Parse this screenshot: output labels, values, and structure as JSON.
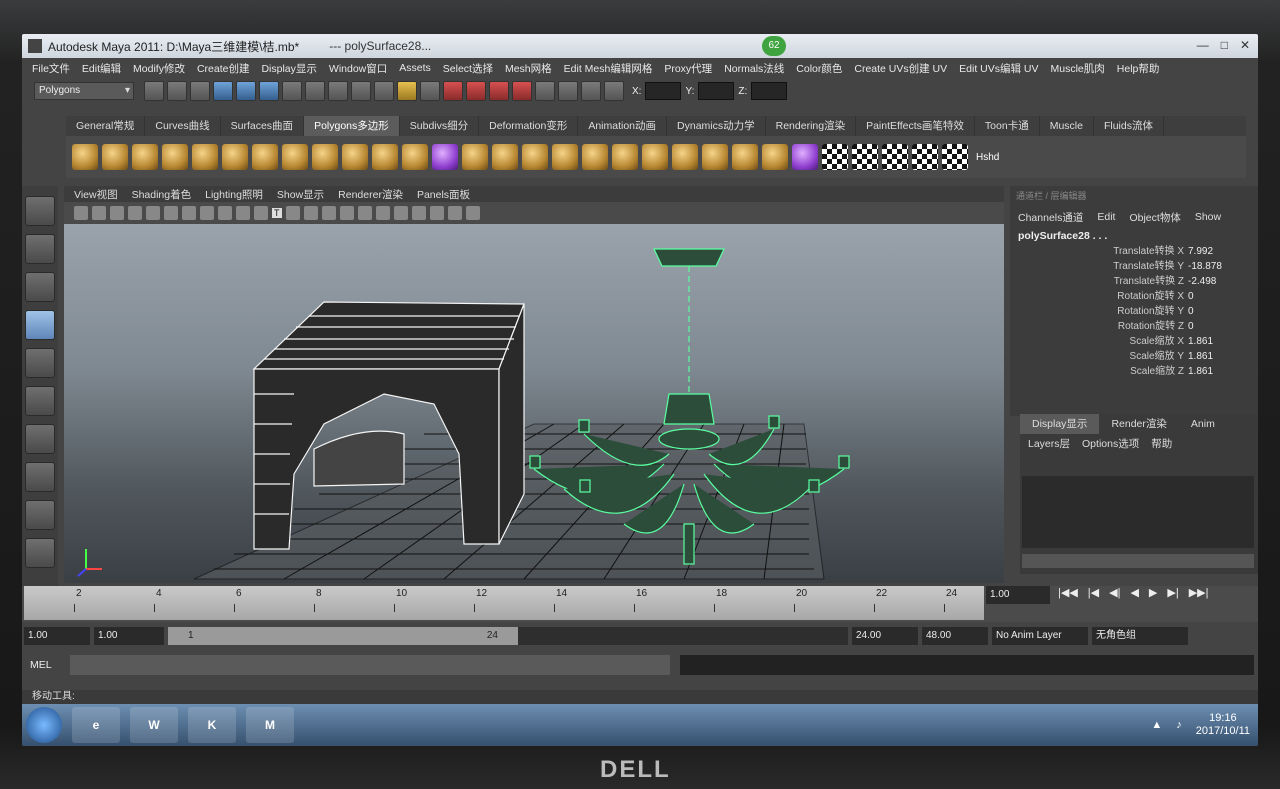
{
  "window": {
    "title": "Autodesk Maya 2011: D:\\Maya三维建模\\桔.mb*",
    "subtitle": "---  polySurface28...",
    "badge": "62",
    "buttons": [
      "—",
      "□",
      "✕"
    ]
  },
  "menu": [
    "File文件",
    "Edit编辑",
    "Modify修改",
    "Create创建",
    "Display显示",
    "Window窗口",
    "Assets",
    "Select选择",
    "Mesh网格",
    "Edit Mesh编辑网格",
    "Proxy代理",
    "Normals法线",
    "Color颜色",
    "Create UVs创建 UV",
    "Edit UVs编辑 UV",
    "Muscle肌肉",
    "Help帮助"
  ],
  "status": {
    "mode": "Polygons",
    "x_label": "X:",
    "y_label": "Y:",
    "z_label": "Z:"
  },
  "shelf_tabs": [
    "General常规",
    "Curves曲线",
    "Surfaces曲面",
    "Polygons多边形",
    "Subdivs细分",
    "Deformation变形",
    "Animation动画",
    "Dynamics动力学",
    "Rendering渲染",
    "PaintEffects画笔特效",
    "Toon卡通",
    "Muscle",
    "Fluids流体"
  ],
  "shelf_active": "Polygons多边形",
  "shelf_hshd": "Hshd",
  "viewport": {
    "menu": [
      "View视图",
      "Shading着色",
      "Lighting照明",
      "Show显示",
      "Renderer渲染",
      "Panels面板"
    ],
    "tooltip": "T"
  },
  "channel_box": {
    "header": "通道栏 / 层编辑器",
    "tabs": [
      "Channels通道",
      "Edit",
      "Object物体",
      "Show"
    ],
    "object": "polySurface28 . . .",
    "attributes": [
      {
        "name": "Translate转换 X",
        "value": "7.992"
      },
      {
        "name": "Translate转换 Y",
        "value": "-18.878"
      },
      {
        "name": "Translate转换 Z",
        "value": "-2.498"
      },
      {
        "name": "Rotation旋转 X",
        "value": "0"
      },
      {
        "name": "Rotation旋转 Y",
        "value": "0"
      },
      {
        "name": "Rotation旋转 Z",
        "value": "0"
      },
      {
        "name": "Scale缩放 X",
        "value": "1.861"
      },
      {
        "name": "Scale缩放 Y",
        "value": "1.861"
      },
      {
        "name": "Scale缩放 Z",
        "value": "1.861"
      }
    ]
  },
  "layer_editor": {
    "tabs": [
      "Display显示",
      "Render渲染",
      "Anim"
    ],
    "sub": [
      "Layers层",
      "Options选项",
      "帮助"
    ]
  },
  "timeline": {
    "ticks": [
      "2",
      "4",
      "6",
      "8",
      "10",
      "12",
      "14",
      "16",
      "18",
      "20",
      "22",
      "24"
    ],
    "current": "1.00",
    "transport": [
      "|◀◀",
      "|◀",
      "◀|",
      "◀",
      "▶",
      "▶|",
      "▶▶|"
    ]
  },
  "range": {
    "start": "1.00",
    "start2": "1.00",
    "slider_start": "1",
    "slider_end": "24",
    "end": "24.00",
    "end2": "48.00",
    "anim_layer": "No Anim Layer",
    "char_set": "无角色组"
  },
  "mel": {
    "label": "MEL"
  },
  "help_line": "移动工具:",
  "taskbar": {
    "time": "19:16",
    "date": "2017/10/11",
    "apps": [
      "e",
      "W",
      "K",
      "M"
    ]
  },
  "monitor_brand": "DELL"
}
